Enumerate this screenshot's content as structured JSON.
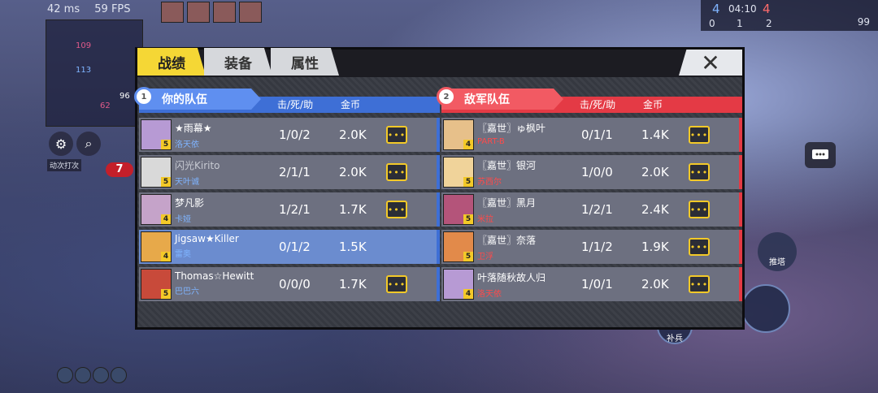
{
  "hud": {
    "ping": "42 ms",
    "fps": "59 FPS",
    "time": "04:10",
    "blue_kills": "4",
    "red_kills": "4",
    "deaths": "0",
    "assists": "1",
    "cs": "2",
    "gold": "99",
    "map_numbers": [
      "109",
      "113",
      "62",
      "96"
    ]
  },
  "side": {
    "label_small": "动次打次",
    "red_count": "7",
    "tower_label": "推塔",
    "minion_label": "补兵"
  },
  "tabs": [
    {
      "label": "战绩"
    },
    {
      "label": "装备"
    },
    {
      "label": "属性"
    }
  ],
  "close_label": "✕",
  "left_team": {
    "title": "你的队伍",
    "col_kda": "击/死/助",
    "col_gold": "金币",
    "star": "1",
    "players": [
      {
        "name": "★雨幕★",
        "hero": "洛天依",
        "level": "5",
        "kda": "1/0/2",
        "gold": "2.0K",
        "color": "#b79ad4",
        "has_chat": true
      },
      {
        "name": "闪光Kirito",
        "hero": "天叶诚",
        "level": "5",
        "kda": "2/1/1",
        "gold": "2.0K",
        "color": "#d9d9d9",
        "has_chat": true
      },
      {
        "name": "梦凡影",
        "hero": "卡娅",
        "level": "4",
        "kda": "1/2/1",
        "gold": "1.7K",
        "color": "#c5a3c9",
        "has_chat": true
      },
      {
        "name": "Jigsaw★Killer",
        "hero": "雷奥",
        "level": "4",
        "kda": "0/1/2",
        "gold": "1.5K",
        "color": "#e7a94a",
        "has_chat": false
      },
      {
        "name": "Thomas☆Hewitt",
        "hero": "巴巴六",
        "level": "5",
        "kda": "0/0/0",
        "gold": "1.7K",
        "color": "#c84a3a",
        "has_chat": true
      }
    ]
  },
  "right_team": {
    "title": "敌军队伍",
    "col_kda": "击/死/助",
    "col_gold": "金币",
    "star": "2",
    "players": [
      {
        "name": "〖嘉世〗ゅ枫叶",
        "hero": "PART-B",
        "level": "4",
        "kda": "0/1/1",
        "gold": "1.4K",
        "color": "#e7c08a"
      },
      {
        "name": "〖嘉世〗银河",
        "hero": "苏西尔",
        "level": "5",
        "kda": "1/0/0",
        "gold": "2.0K",
        "color": "#f0d39a"
      },
      {
        "name": "〖嘉世〗黑月",
        "hero": "米拉",
        "level": "5",
        "kda": "1/2/1",
        "gold": "2.4K",
        "color": "#b4547a"
      },
      {
        "name": "〖嘉世〗奈落",
        "hero": "卫浮",
        "level": "5",
        "kda": "1/1/2",
        "gold": "1.9K",
        "color": "#e28a4a"
      },
      {
        "name": "叶落随秋故人归",
        "hero": "洛天依",
        "level": "4",
        "kda": "1/0/1",
        "gold": "2.0K",
        "color": "#b79ad4"
      }
    ]
  }
}
